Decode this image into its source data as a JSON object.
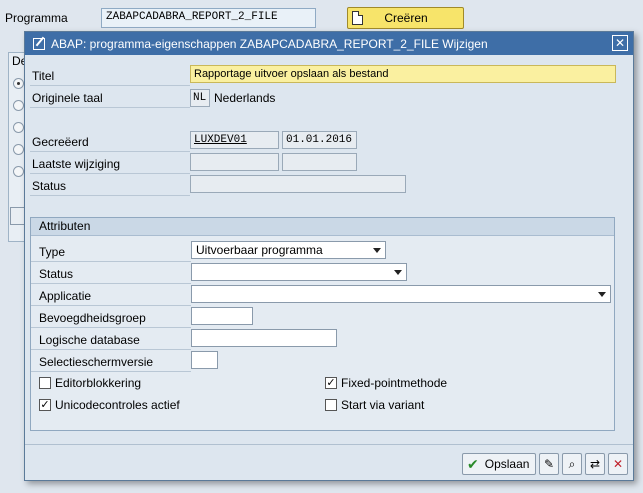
{
  "background": {
    "program_label": "Programma",
    "program_value": "ZABAPCADABRA_REPORT_2_FILE",
    "create_button": "Creëren",
    "group_title": "De"
  },
  "dialog": {
    "title": "ABAP: programma-eigenschappen ZABAPCADABRA_REPORT_2_FILE Wijzigen",
    "titel_label": "Titel",
    "titel_value": "Rapportage uitvoer opslaan als bestand",
    "taal_label": "Originele taal",
    "taal_code": "NL",
    "taal_name": "Nederlands",
    "gecreeerd_label": "Gecreëerd",
    "gecreeerd_user": "LUXDEV01",
    "gecreeerd_date": "01.01.2016",
    "wijziging_label": "Laatste wijziging",
    "wijziging_user": "",
    "wijziging_date": "",
    "status_label": "Status",
    "status_value": ""
  },
  "attributes": {
    "header": "Attributen",
    "type_label": "Type",
    "type_value": "Uitvoerbaar programma",
    "status_label": "Status",
    "status_value": "",
    "applicatie_label": "Applicatie",
    "applicatie_value": "",
    "bevoegd_label": "Bevoegdheidsgroep",
    "bevoegd_value": "",
    "logdb_label": "Logische database",
    "logdb_value": "",
    "selectie_label": "Selectieschermversie",
    "selectie_value": "",
    "editor_label": "Editorblokkering",
    "editor_checked": false,
    "unicode_label": "Unicodecontroles actief",
    "unicode_checked": true,
    "fixed_label": "Fixed-pointmethode",
    "fixed_checked": true,
    "variant_label": "Start via variant",
    "variant_checked": false
  },
  "footer": {
    "save_label": "Opslaan",
    "check_glyph": "✔"
  }
}
